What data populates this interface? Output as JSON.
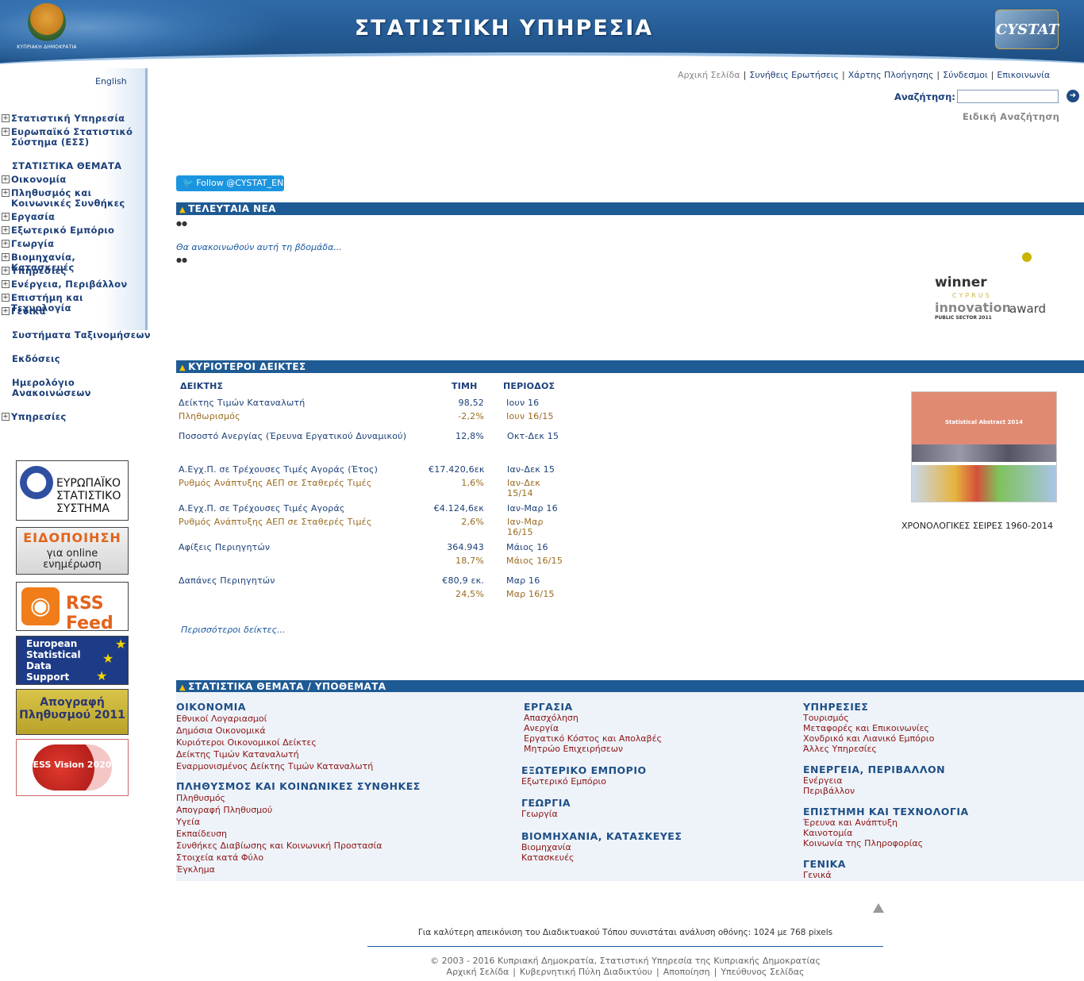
{
  "header": {
    "title": "ΣΤΑΤΙΣΤΙΚΗ ΥΠΗΡΕΣΙΑ",
    "emblem_caption": "ΚΥΠΡΙΑΚΗ ΔΗΜΟΚΡΑΤΙΑ",
    "logo_text": "CYSTAT"
  },
  "language_link": "English",
  "top_links": [
    "Αρχική Σελίδα",
    "Συνήθεις Ερωτήσεις",
    "Χάρτης Πλοήγησης",
    "Σύνδεσμοι",
    "Επικοινωνία"
  ],
  "search": {
    "label": "Αναζήτηση:",
    "value": "",
    "go": "➜",
    "advanced": "Ειδική Αναζήτηση"
  },
  "sidebar": {
    "group1": [
      "Στατιστική Υπηρεσία",
      "Ευρωπαϊκό Στατιστικό Σύστημα (ΕΣΣ)"
    ],
    "topics_heading": "ΣΤΑΤΙΣΤΙΚΑ ΘΕΜΑΤΑ",
    "topics": [
      "Οικονομία",
      "Πληθυσμός και Κοινωνικές Συνθήκες",
      "Εργασία",
      "Εξωτερικό Εμπόριο",
      "Γεωργία",
      "Βιομηχανία, Κατασκευές",
      "Υπηρεσίες",
      "Ενέργεια, Περιβάλλον",
      "Επιστήμη και Τεχνολογία",
      "Γενικά"
    ],
    "classification": "Συστήματα Ταξινομήσεων",
    "publications": "Εκδόσεις",
    "calendar": "Ημερολόγιο Ανακοινώσεων",
    "services": "Υπηρεσίες",
    "plus": "+"
  },
  "banners": {
    "ess": "ΕΥΡΩΠΑΪΚΟ ΣΤΑΤΙΣΤΙΚΟ ΣΥΣΤΗΜΑ",
    "eid_1": "ΕΙΔΟΠΟΙΗΣΗ",
    "eid_2": "για online ενημέρωση",
    "rss": "RSS Feed",
    "esds": [
      "European",
      "Statistical",
      "Data",
      "Support"
    ],
    "census": "Απογραφή Πληθυσμού 2011",
    "vision": "ESS Vision 2020"
  },
  "twitter": "Follow @CYSTAT_EN",
  "news": {
    "heading": "ΤΕΛΕΥΤΑΙΑ ΝΕΑ",
    "announcement": "Θα ανακοινωθούν αυτή τη βδομάδα..."
  },
  "award": {
    "winner": "winner",
    "cyprus": "CYPRUS",
    "innovation": "innovation",
    "award": "award",
    "sector": "PUBLIC SECTOR 2011"
  },
  "indicators": {
    "heading": "ΚΥΡΙΟΤΕΡΟΙ ΔΕΙΚΤΕΣ",
    "columns": [
      "ΔΕΙΚΤΗΣ",
      "ΤΙΜΗ",
      "ΠΕΡΙΟΔΟΣ"
    ],
    "rows": [
      {
        "label": "Δείκτης Τιμών Καταναλωτή",
        "value": "98,52",
        "period": "Ιουν 16",
        "sub": false
      },
      {
        "label": "Πληθωρισμός",
        "value": "-2,2%",
        "period": "Ιουν 16/15",
        "sub": true
      },
      {
        "label": "Ποσοστό Ανεργίας (Έρευνα Εργατικού Δυναμικού)",
        "value": "12,8%",
        "period": "Οκτ-Δεκ 15",
        "sub": false
      },
      {
        "label": "Α.Εγχ.Π. σε Τρέχουσες Τιμές Αγοράς (Έτος)",
        "value": "€17.420,6εκ",
        "period": "Ιαν-Δεκ 15",
        "sub": false
      },
      {
        "label": "Ρυθμός Ανάπτυξης ΑΕΠ σε Σταθερές Τιμές",
        "value": "1,6%",
        "period": "Ιαν-Δεκ 15/14",
        "sub": true
      },
      {
        "label": "Α.Εγχ.Π. σε Τρέχουσες Τιμές Αγοράς",
        "value": "€4.124,6εκ",
        "period": "Ιαν-Μαρ 16",
        "sub": false
      },
      {
        "label": "Ρυθμός Ανάπτυξης ΑΕΠ σε Σταθερές Τιμές",
        "value": "2,6%",
        "period": "Ιαν-Μαρ 16/15",
        "sub": true
      },
      {
        "label": "Αφίξεις Περιηγητών",
        "value": "364.943",
        "period": "Μάιος 16",
        "sub": false
      },
      {
        "label": "",
        "value": "18,7%",
        "period": "Μάιος 16/15",
        "sub": true
      },
      {
        "label": "Δαπάνες Περιηγητών",
        "value": "€80,9 εκ.",
        "period": "Μαρ 16",
        "sub": false
      },
      {
        "label": "",
        "value": "24,5%",
        "period": "Μαρ 16/15",
        "sub": true
      }
    ],
    "more": "Περισσότεροι δείκτες..."
  },
  "abstract": {
    "cover_title": "Statistical Abstract 2014",
    "caption": "ΧΡΟΝΟΛΟΓΙΚΕΣ ΣΕΙΡΕΣ 1960-2014"
  },
  "topics": {
    "heading": "ΣΤΑΤΙΣΤΙΚΑ ΘΕΜΑΤΑ / ΥΠΟΘΕΜΑΤΑ",
    "economy": {
      "title": "ΟΙΚΟΝΟΜΙΑ",
      "items": [
        "Εθνικοί Λογαριασμοί",
        "Δημόσια Οικονομικά",
        "Κυριότεροι Οικονομικοί Δείκτες",
        "Δείκτης Τιμών Καταναλωτή",
        "Εναρμονισμένος Δείκτης Τιμών  Καταναλωτή"
      ]
    },
    "population": {
      "title": "ΠΛΗΘΥΣΜΟΣ ΚΑΙ ΚΟΙΝΩΝΙΚΕΣ ΣΥΝΘΗΚΕΣ",
      "items": [
        "Πληθυσμός",
        "Απογραφή Πληθυσμού",
        "Υγεία",
        "Εκπαίδευση",
        "Συνθήκες Διαβίωσης και Κοινωνική  Προστασία",
        "Στοιχεία κατά Φύλο",
        "Έγκλημα"
      ]
    },
    "labour": {
      "title": "ΕΡΓΑΣΙΑ",
      "items": [
        "Απασχόληση",
        "Ανεργία",
        "Εργατικό Κόστος και Απολαβές",
        "Μητρώο Επιχειρήσεων"
      ]
    },
    "trade": {
      "title": "ΕΞΩΤΕΡΙΚΟ ΕΜΠΟΡΙΟ",
      "items": [
        "Εξωτερικό Εμπόριο"
      ]
    },
    "agriculture": {
      "title": "ΓΕΩΡΓΙΑ",
      "items": [
        "Γεωργία"
      ]
    },
    "industry": {
      "title": "ΒΙΟΜΗΧΑΝΙΑ, ΚΑΤΑΣΚΕΥΕΣ",
      "items": [
        "Βιομηχανία",
        "Κατασκευές"
      ]
    },
    "services": {
      "title": "ΥΠΗΡΕΣΙΕΣ",
      "items": [
        "Τουρισμός",
        "Μεταφορές και Επικοινωνίες",
        "Χονδρικό και Λιανικό Εμπόριο",
        "Άλλες Υπηρεσίες"
      ]
    },
    "energy": {
      "title": "ΕΝΕΡΓΕΙΑ, ΠΕΡΙΒΑΛΛΟΝ",
      "items": [
        "Ενέργεια",
        "Περιβάλλον"
      ]
    },
    "science": {
      "title": "ΕΠΙΣΤΗΜΗ ΚΑΙ ΤΕΧΝΟΛΟΓΙΑ",
      "items": [
        "Έρευνα και Ανάπτυξη",
        "Καινοτομία",
        "Κοινωνία της Πληροφορίας"
      ]
    },
    "general": {
      "title": "ΓΕΝΙΚΑ",
      "items": [
        "Γενικά"
      ]
    }
  },
  "footer": {
    "resolution_note": "Για καλύτερη απεικόνιση του Διαδικτυακού Τόπου συνιστάται ανάλυση οθόνης: 1024 με 768 pixels",
    "copyright": "© 2003 - 2016 Κυπριακή Δημοκρατία, Στατιστική Υπηρεσία της Κυπριακής Δημοκρατίας",
    "links": [
      "Αρχική Σελίδα",
      "Κυβερνητική Πύλη Διαδικτύου",
      "Αποποίηση",
      "Υπεύθυνος Σελίδας"
    ]
  },
  "colors": {
    "header_blue": "#23588f",
    "bar_blue": "#1e5a94",
    "link_navy": "#1b3f78",
    "sub_brown": "#9a6b1f",
    "topic_red": "#8a1414"
  }
}
